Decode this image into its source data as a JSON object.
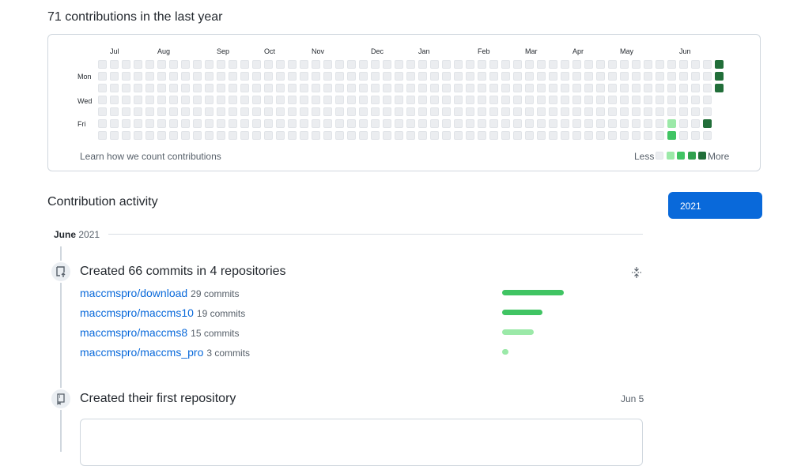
{
  "summary": {
    "heading": "71 contributions in the last year"
  },
  "calendar": {
    "months": [
      "Jul",
      "Aug",
      "Sep",
      "Oct",
      "Nov",
      "Dec",
      "Jan",
      "Feb",
      "Mar",
      "Apr",
      "May",
      "Jun"
    ],
    "days": [
      "Mon",
      "Wed",
      "Fri"
    ],
    "weeks": 53,
    "empty_color": "#ebedf0",
    "level_colors": [
      "#ebedf0",
      "#9be9a8",
      "#40c463",
      "#30a14e",
      "#216e39"
    ],
    "active_cells": [
      {
        "week": 52,
        "day": 0,
        "level": 4
      },
      {
        "week": 52,
        "day": 1,
        "level": 4
      },
      {
        "week": 52,
        "day": 2,
        "level": 4
      },
      {
        "week": 51,
        "day": 5,
        "level": 4
      },
      {
        "week": 48,
        "day": 5,
        "level": 1
      },
      {
        "week": 48,
        "day": 6,
        "level": 2
      }
    ],
    "learn_link": "Learn how we count contributions",
    "legend_less": "Less",
    "legend_more": "More"
  },
  "activity": {
    "title": "Contribution activity",
    "year_button": "2021",
    "month_name": "June",
    "month_year": "2021",
    "commits_title": "Created 66 commits in 4 repositories",
    "repos": [
      {
        "name": "maccmspro/download",
        "commits": "29 commits",
        "count": 29
      },
      {
        "name": "maccmspro/maccms10",
        "commits": "19 commits",
        "count": 19
      },
      {
        "name": "maccmspro/maccms8",
        "commits": "15 commits",
        "count": 15
      },
      {
        "name": "maccmspro/maccms_pro",
        "commits": "3 commits",
        "count": 3
      }
    ],
    "bar_colors": [
      "#40c463",
      "#40c463",
      "#9be9a8",
      "#9be9a8"
    ],
    "first_repo_title": "Created their first repository",
    "first_repo_date": "Jun 5"
  }
}
